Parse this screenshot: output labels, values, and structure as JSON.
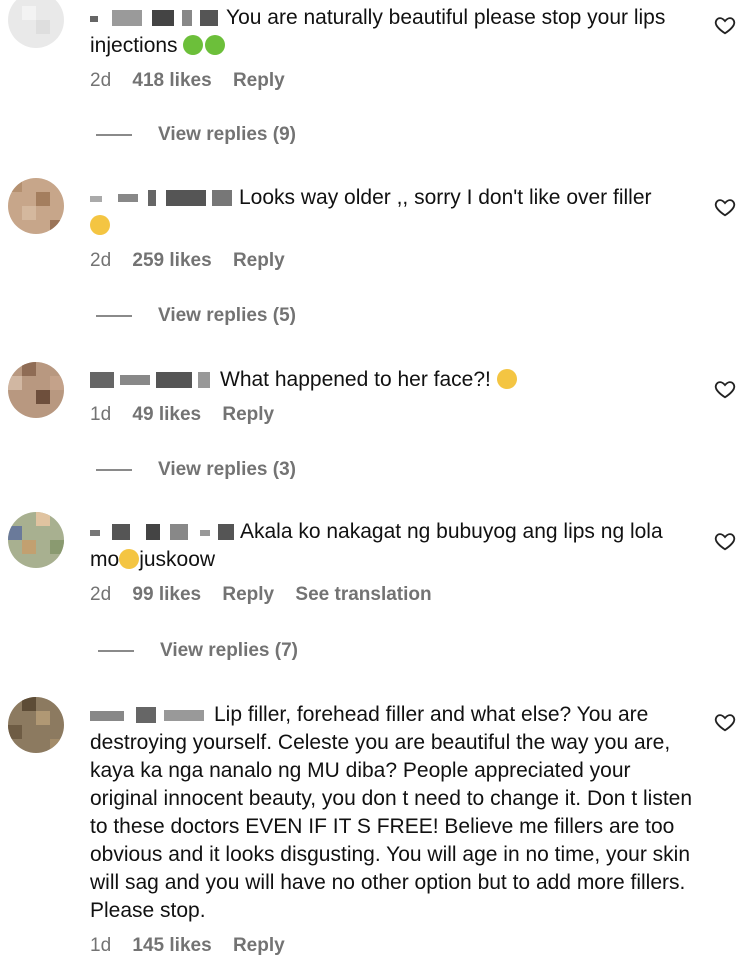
{
  "comments": [
    {
      "text": "You are naturally beautiful please stop your lips injections",
      "emoji": [
        "green-sick",
        "green-sick"
      ],
      "date": "2d",
      "likes": "418 likes",
      "reply": "Reply",
      "view_replies": "View replies (9)"
    },
    {
      "text": "Looks way older ,, sorry I don't like over filler",
      "emoji_after": [
        "crying"
      ],
      "date": "2d",
      "likes": "259 likes",
      "reply": "Reply",
      "view_replies": "View replies (5)"
    },
    {
      "text": "What happened to her face?!",
      "emoji_after": [
        "pensive"
      ],
      "date": "1d",
      "likes": "49 likes",
      "reply": "Reply",
      "view_replies": "View replies (3)"
    },
    {
      "text_a": "Akala ko nakagat ng bubuyog ang lips ng lola",
      "text_b1": "mo",
      "text_b2": "juskoow",
      "date": "2d",
      "likes": "99 likes",
      "reply": "Reply",
      "translation": "See translation",
      "view_replies": "View replies (7)"
    },
    {
      "text": "Lip filler, forehead filler and what else? You are destroying yourself. Celeste you are beautiful the way you are, kaya ka nga nanalo ng MU diba? People appreciated your original innocent beauty, you don t need to change it. Don t listen to these doctors EVEN IF IT S FREE! Believe me fillers are too obvious and it looks disgusting. You will age in no time, your skin will sag and you will have no other option but to add more fillers. Please stop.",
      "date": "1d",
      "likes": "145 likes",
      "reply": "Reply"
    }
  ],
  "colors": {
    "text": "#111111",
    "muted": "#737373"
  },
  "icons": {
    "like": "heart-outline-icon"
  }
}
